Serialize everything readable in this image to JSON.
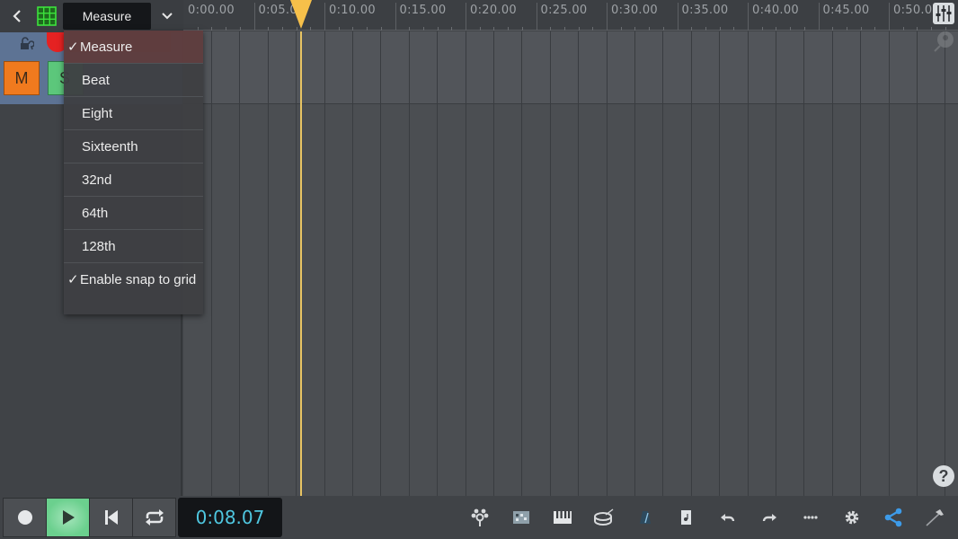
{
  "toolbar": {
    "back_icon": "chevron-left-icon",
    "grid_icon": "grid-icon",
    "snap_value": "Measure",
    "snap_chevron_icon": "chevron-down-icon",
    "mixer_icon": "mixer-sliders-icon",
    "instrument_icon": "instrument-icon"
  },
  "ruler": {
    "labels": [
      "0:00.00",
      "0:05.00",
      "0:10.00",
      "0:15.00",
      "0:20.00",
      "0:25.00",
      "0:30.00",
      "0:35.00",
      "0:40.00",
      "0:45.00",
      "0:50.00"
    ]
  },
  "track": {
    "lock_icon": "lock-icon",
    "mute_label": "M",
    "solo_label": "S",
    "record_arm_color": "#e52222"
  },
  "snap_menu": {
    "items": [
      {
        "label": "Measure",
        "checked": true
      },
      {
        "label": "Beat",
        "checked": false
      },
      {
        "label": "Eight",
        "checked": false
      },
      {
        "label": "Sixteenth",
        "checked": false
      },
      {
        "label": "32nd",
        "checked": false
      },
      {
        "label": "64th",
        "checked": false
      },
      {
        "label": "128th",
        "checked": false
      }
    ],
    "snap_toggle": {
      "label": "Enable snap to grid",
      "checked": true
    },
    "check_glyph": "✓"
  },
  "transport": {
    "record_icon": "record-icon",
    "play_icon": "play-icon",
    "rewind_icon": "skip-to-start-icon",
    "loop_icon": "loop-icon",
    "time": "0:08.07",
    "time_color": "#4fc7e0",
    "play_active_color": "#6bd08e"
  },
  "tools": [
    {
      "name": "fx-icon"
    },
    {
      "name": "pad-icon"
    },
    {
      "name": "keyboard-icon"
    },
    {
      "name": "drum-icon"
    },
    {
      "name": "metronome-icon"
    },
    {
      "name": "score-icon"
    },
    {
      "name": "undo-icon"
    },
    {
      "name": "redo-icon"
    },
    {
      "name": "more-icon"
    },
    {
      "name": "settings-icon"
    },
    {
      "name": "share-icon"
    },
    {
      "name": "hammer-icon"
    }
  ],
  "help": {
    "label": "?"
  },
  "colors": {
    "accent_share": "#3d9be9",
    "playhead": "#f7c04a",
    "mute": "#f07a1e",
    "solo": "#5cc77b"
  }
}
